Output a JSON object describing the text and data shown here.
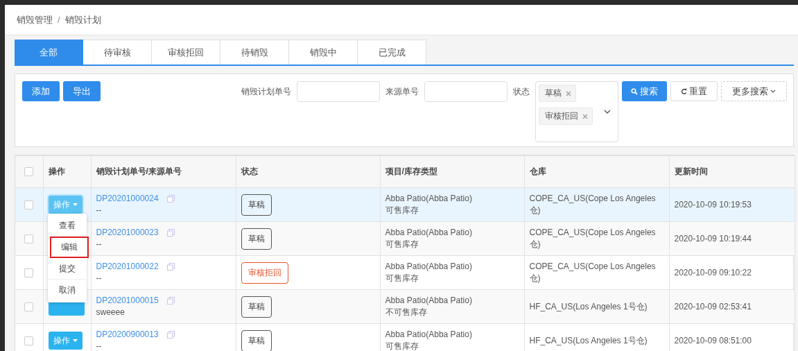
{
  "breadcrumb": {
    "items": [
      "销毁管理",
      "销毁计划"
    ],
    "separator": "/"
  },
  "tabs": [
    {
      "label": "全部",
      "selected": true
    },
    {
      "label": "待审核",
      "selected": false
    },
    {
      "label": "审核拒回",
      "selected": false
    },
    {
      "label": "待销毁",
      "selected": false
    },
    {
      "label": "销毁中",
      "selected": false
    },
    {
      "label": "已完成",
      "selected": false
    }
  ],
  "toolbar": {
    "buttons": [
      "添加",
      "导出"
    ]
  },
  "filters": {
    "fields": [
      {
        "label": "销毁计划单号"
      },
      {
        "label": "来源单号"
      }
    ],
    "status": {
      "label": "状态",
      "tags": [
        "草稿",
        "审核拒回"
      ]
    },
    "search": "搜索",
    "reset": "重置",
    "more": "更多搜索"
  },
  "table": {
    "header_checked": false,
    "columns": [
      "操作",
      "销毁计划单号/来源单号",
      "状态",
      "项目/库存类型",
      "仓库",
      "更新时间"
    ],
    "rows": [
      {
        "checked": false,
        "hovered": true,
        "action": {
          "kind": "button",
          "label": "操作",
          "open": true
        },
        "plan_no": "DP20201000024",
        "source_no": "--",
        "status": {
          "label": "草稿",
          "kind": "draft"
        },
        "project": "Abba Patio(Abba Patio)",
        "stock_type": "可售库存",
        "warehouse": "COPE_CA_US(Cope Los Angeles 仓)",
        "updated": "2020-10-09 10:19:53"
      },
      {
        "checked": false,
        "hovered": false,
        "action": {
          "kind": "covered"
        },
        "plan_no": "DP20201000023",
        "source_no": "--",
        "status": {
          "label": "草稿",
          "kind": "draft"
        },
        "project": "Abba Patio(Abba Patio)",
        "stock_type": "可售库存",
        "warehouse": "COPE_CA_US(Cope Los Angeles 仓)",
        "updated": "2020-10-09 10:19:44"
      },
      {
        "checked": false,
        "hovered": false,
        "action": {
          "kind": "covered"
        },
        "plan_no": "DP20201000022",
        "source_no": "--",
        "status": {
          "label": "审核拒回",
          "kind": "rejected"
        },
        "project": "Abba Patio(Abba Patio)",
        "stock_type": "可售库存",
        "warehouse": "COPE_CA_US(Cope Los Angeles 仓)",
        "updated": "2020-10-09 09:10:22"
      },
      {
        "checked": false,
        "hovered": false,
        "action": {
          "kind": "partly_covered"
        },
        "plan_no": "DP20201000015",
        "source_no": "sweeee",
        "status": {
          "label": "草稿",
          "kind": "draft"
        },
        "project": "Abba Patio(Abba Patio)",
        "stock_type": "不可售库存",
        "warehouse": "HF_CA_US(Los Angeles 1号仓)",
        "updated": "2020-10-09 02:53:41"
      },
      {
        "checked": false,
        "hovered": false,
        "action": {
          "kind": "button",
          "label": "操作",
          "open": false
        },
        "plan_no": "DP20200900013",
        "source_no": "--",
        "status": {
          "label": "草稿",
          "kind": "draft"
        },
        "project": "Abba Patio(Abba Patio)",
        "stock_type": "可售库存",
        "warehouse": "HF_CA_US(Los Angeles 1号仓)",
        "updated": "2020-10-09 08:51:00"
      }
    ]
  },
  "action_menu": {
    "items": [
      {
        "label": "查看",
        "highlighted": false
      },
      {
        "label": "编辑",
        "highlighted": true
      },
      {
        "label": "提交",
        "highlighted": false
      },
      {
        "label": "取消",
        "highlighted": false
      }
    ]
  }
}
